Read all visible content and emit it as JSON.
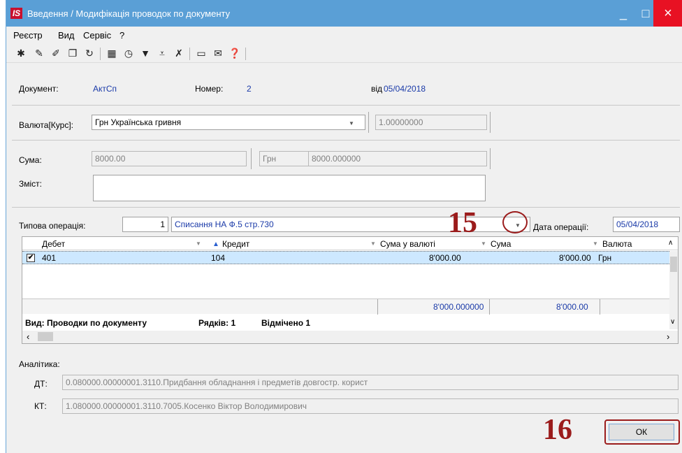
{
  "window": {
    "title": "Введення / Модифікація проводок по документу",
    "app_icon": "IS",
    "controls": {
      "minimize": "_",
      "maximize": "□",
      "close": "×"
    }
  },
  "menu": [
    "Реєстр",
    "Вид",
    "Сервіс",
    "?"
  ],
  "toolbar_icons": [
    "new-doc-icon",
    "copy-doc-icon",
    "edit-doc-icon",
    "duplicate-icon",
    "refresh-icon",
    "table-icon",
    "clock-icon",
    "filter-icon",
    "filter-clear-icon",
    "filter-remove-icon",
    "calc-icon",
    "mail-icon",
    "help-icon"
  ],
  "document": {
    "label": "Документ:",
    "value": "АктСп",
    "number_label": "Номер:",
    "number": "2",
    "date_label": "від",
    "date": "05/04/2018"
  },
  "currency": {
    "label": "Валюта[Курс]:",
    "value": "Грн Українська гривня",
    "rate": "1.00000000"
  },
  "sum": {
    "label": "Сума:",
    "value": "8000.00",
    "currency": "Грн",
    "converted": "8000.000000"
  },
  "content": {
    "label": "Зміст:",
    "value": ""
  },
  "operation": {
    "label": "Типова операція:",
    "code": "1",
    "name": "Списання НА Ф.5 стр.730",
    "date_label": "Дата операції:",
    "date": "05/04/2018"
  },
  "grid": {
    "columns": [
      "Дебет",
      "Кредит",
      "Сума у валюті",
      "Сума",
      "Валюта"
    ],
    "rows": [
      {
        "checked": "✔",
        "debit": "401",
        "credit": "104",
        "sum_currency": "8'000.00",
        "sum": "8'000.00",
        "currency": "Грн"
      }
    ],
    "totals": {
      "sum_currency": "8'000.000000",
      "sum": "8'000.00"
    },
    "status": {
      "view": "Вид: Проводки по документу",
      "rows": "Рядків: 1",
      "marked": "Відмічено 1"
    }
  },
  "analytics": {
    "label": "Аналітика:",
    "dt_label": "ДТ:",
    "dt_value": "0.080000.00000001.3110.Придбання обладнання і предметів довгостр. корист",
    "kt_label": "КТ:",
    "kt_value": "1.080000.00000001.3110.7005.Косенко Віктор Володимирович"
  },
  "annotations": {
    "marker_15": "15",
    "marker_16": "16"
  },
  "buttons": {
    "ok": "ОК"
  },
  "colors": {
    "titlebar": "#5a9fd6",
    "selection": "#cde8ff",
    "annotation": "#9b1c1c",
    "link_text": "#1a3aa8"
  }
}
